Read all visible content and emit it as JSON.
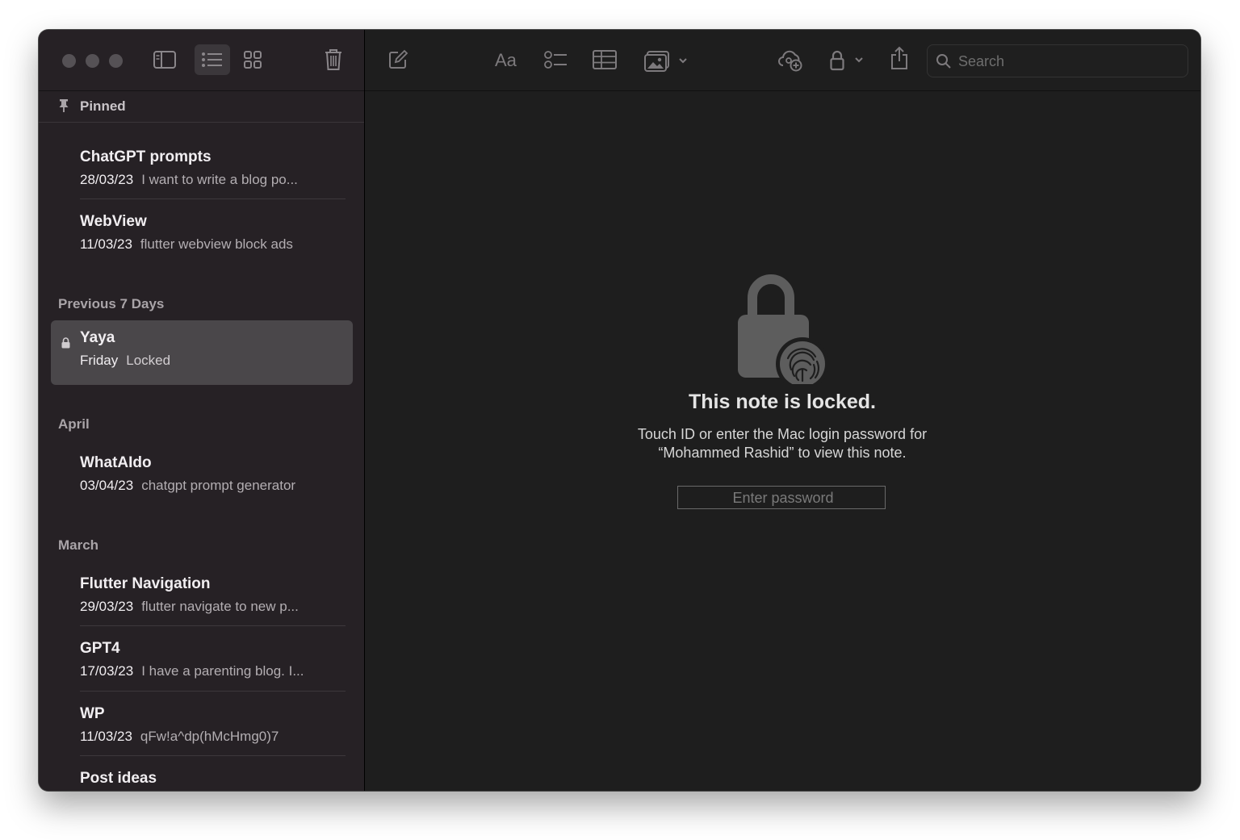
{
  "window": {
    "traffic_lights": [
      "close",
      "minimize",
      "zoom"
    ]
  },
  "sidebar_toolbar": {
    "buttons": [
      "sidebar-toggle-icon",
      "list-view-icon",
      "gallery-view-icon",
      "trash-icon"
    ],
    "active": "list-view-icon"
  },
  "sidebar": {
    "pinned_label": "Pinned",
    "sections": [
      {
        "label": "Previous 7 Days"
      },
      {
        "label": "April"
      },
      {
        "label": "March"
      }
    ],
    "notes": [
      {
        "title": "ChatGPT prompts",
        "date": "28/03/23",
        "preview": "I want to write a blog po..."
      },
      {
        "title": "WebView",
        "date": "11/03/23",
        "preview": "flutter webview block ads"
      },
      {
        "title": "Yaya",
        "date": "Friday",
        "preview": "Locked",
        "locked": true,
        "selected": true
      },
      {
        "title": "WhatAIdo",
        "date": "03/04/23",
        "preview": "chatgpt prompt generator"
      },
      {
        "title": "Flutter Navigation",
        "date": "29/03/23",
        "preview": "flutter navigate to new p..."
      },
      {
        "title": "GPT4",
        "date": "17/03/23",
        "preview": "I have a parenting blog. I..."
      },
      {
        "title": "WP",
        "date": "11/03/23",
        "preview": "qFw!a^dp(hMcHmg0)7"
      },
      {
        "title": "Post ideas",
        "date": "",
        "preview": ""
      }
    ]
  },
  "main_toolbar": {
    "icons": [
      "compose-icon",
      "text-format-icon",
      "checklist-icon",
      "table-icon",
      "media-icon",
      "collaborate-icon",
      "lock-icon",
      "share-icon"
    ],
    "search_placeholder": "Search"
  },
  "locked_note": {
    "title": "This note is locked.",
    "line1": "Touch ID or enter the Mac login password for",
    "line2": "“Mohammed Rashid” to view this note.",
    "password_placeholder": "Enter password"
  },
  "colors": {
    "sidebar_bg": "#262125",
    "main_bg": "#1e1e1e",
    "selected_row": "#4a474a",
    "icon_gray": "#7d7a7d"
  }
}
